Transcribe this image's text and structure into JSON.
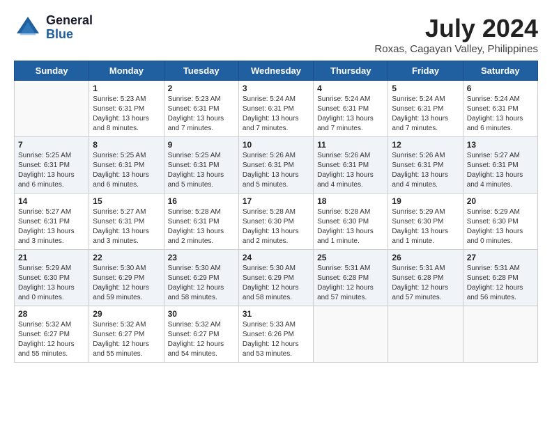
{
  "header": {
    "logo_general": "General",
    "logo_blue": "Blue",
    "month_year": "July 2024",
    "location": "Roxas, Cagayan Valley, Philippines"
  },
  "weekdays": [
    "Sunday",
    "Monday",
    "Tuesday",
    "Wednesday",
    "Thursday",
    "Friday",
    "Saturday"
  ],
  "weeks": [
    [
      {
        "day": "",
        "empty": true
      },
      {
        "day": "1",
        "sunrise": "Sunrise: 5:23 AM",
        "sunset": "Sunset: 6:31 PM",
        "daylight": "Daylight: 13 hours and 8 minutes."
      },
      {
        "day": "2",
        "sunrise": "Sunrise: 5:23 AM",
        "sunset": "Sunset: 6:31 PM",
        "daylight": "Daylight: 13 hours and 7 minutes."
      },
      {
        "day": "3",
        "sunrise": "Sunrise: 5:24 AM",
        "sunset": "Sunset: 6:31 PM",
        "daylight": "Daylight: 13 hours and 7 minutes."
      },
      {
        "day": "4",
        "sunrise": "Sunrise: 5:24 AM",
        "sunset": "Sunset: 6:31 PM",
        "daylight": "Daylight: 13 hours and 7 minutes."
      },
      {
        "day": "5",
        "sunrise": "Sunrise: 5:24 AM",
        "sunset": "Sunset: 6:31 PM",
        "daylight": "Daylight: 13 hours and 7 minutes."
      },
      {
        "day": "6",
        "sunrise": "Sunrise: 5:24 AM",
        "sunset": "Sunset: 6:31 PM",
        "daylight": "Daylight: 13 hours and 6 minutes."
      }
    ],
    [
      {
        "day": "7",
        "sunrise": "Sunrise: 5:25 AM",
        "sunset": "Sunset: 6:31 PM",
        "daylight": "Daylight: 13 hours and 6 minutes."
      },
      {
        "day": "8",
        "sunrise": "Sunrise: 5:25 AM",
        "sunset": "Sunset: 6:31 PM",
        "daylight": "Daylight: 13 hours and 6 minutes."
      },
      {
        "day": "9",
        "sunrise": "Sunrise: 5:25 AM",
        "sunset": "Sunset: 6:31 PM",
        "daylight": "Daylight: 13 hours and 5 minutes."
      },
      {
        "day": "10",
        "sunrise": "Sunrise: 5:26 AM",
        "sunset": "Sunset: 6:31 PM",
        "daylight": "Daylight: 13 hours and 5 minutes."
      },
      {
        "day": "11",
        "sunrise": "Sunrise: 5:26 AM",
        "sunset": "Sunset: 6:31 PM",
        "daylight": "Daylight: 13 hours and 4 minutes."
      },
      {
        "day": "12",
        "sunrise": "Sunrise: 5:26 AM",
        "sunset": "Sunset: 6:31 PM",
        "daylight": "Daylight: 13 hours and 4 minutes."
      },
      {
        "day": "13",
        "sunrise": "Sunrise: 5:27 AM",
        "sunset": "Sunset: 6:31 PM",
        "daylight": "Daylight: 13 hours and 4 minutes."
      }
    ],
    [
      {
        "day": "14",
        "sunrise": "Sunrise: 5:27 AM",
        "sunset": "Sunset: 6:31 PM",
        "daylight": "Daylight: 13 hours and 3 minutes."
      },
      {
        "day": "15",
        "sunrise": "Sunrise: 5:27 AM",
        "sunset": "Sunset: 6:31 PM",
        "daylight": "Daylight: 13 hours and 3 minutes."
      },
      {
        "day": "16",
        "sunrise": "Sunrise: 5:28 AM",
        "sunset": "Sunset: 6:31 PM",
        "daylight": "Daylight: 13 hours and 2 minutes."
      },
      {
        "day": "17",
        "sunrise": "Sunrise: 5:28 AM",
        "sunset": "Sunset: 6:30 PM",
        "daylight": "Daylight: 13 hours and 2 minutes."
      },
      {
        "day": "18",
        "sunrise": "Sunrise: 5:28 AM",
        "sunset": "Sunset: 6:30 PM",
        "daylight": "Daylight: 13 hours and 1 minute."
      },
      {
        "day": "19",
        "sunrise": "Sunrise: 5:29 AM",
        "sunset": "Sunset: 6:30 PM",
        "daylight": "Daylight: 13 hours and 1 minute."
      },
      {
        "day": "20",
        "sunrise": "Sunrise: 5:29 AM",
        "sunset": "Sunset: 6:30 PM",
        "daylight": "Daylight: 13 hours and 0 minutes."
      }
    ],
    [
      {
        "day": "21",
        "sunrise": "Sunrise: 5:29 AM",
        "sunset": "Sunset: 6:30 PM",
        "daylight": "Daylight: 13 hours and 0 minutes."
      },
      {
        "day": "22",
        "sunrise": "Sunrise: 5:30 AM",
        "sunset": "Sunset: 6:29 PM",
        "daylight": "Daylight: 12 hours and 59 minutes."
      },
      {
        "day": "23",
        "sunrise": "Sunrise: 5:30 AM",
        "sunset": "Sunset: 6:29 PM",
        "daylight": "Daylight: 12 hours and 58 minutes."
      },
      {
        "day": "24",
        "sunrise": "Sunrise: 5:30 AM",
        "sunset": "Sunset: 6:29 PM",
        "daylight": "Daylight: 12 hours and 58 minutes."
      },
      {
        "day": "25",
        "sunrise": "Sunrise: 5:31 AM",
        "sunset": "Sunset: 6:28 PM",
        "daylight": "Daylight: 12 hours and 57 minutes."
      },
      {
        "day": "26",
        "sunrise": "Sunrise: 5:31 AM",
        "sunset": "Sunset: 6:28 PM",
        "daylight": "Daylight: 12 hours and 57 minutes."
      },
      {
        "day": "27",
        "sunrise": "Sunrise: 5:31 AM",
        "sunset": "Sunset: 6:28 PM",
        "daylight": "Daylight: 12 hours and 56 minutes."
      }
    ],
    [
      {
        "day": "28",
        "sunrise": "Sunrise: 5:32 AM",
        "sunset": "Sunset: 6:27 PM",
        "daylight": "Daylight: 12 hours and 55 minutes."
      },
      {
        "day": "29",
        "sunrise": "Sunrise: 5:32 AM",
        "sunset": "Sunset: 6:27 PM",
        "daylight": "Daylight: 12 hours and 55 minutes."
      },
      {
        "day": "30",
        "sunrise": "Sunrise: 5:32 AM",
        "sunset": "Sunset: 6:27 PM",
        "daylight": "Daylight: 12 hours and 54 minutes."
      },
      {
        "day": "31",
        "sunrise": "Sunrise: 5:33 AM",
        "sunset": "Sunset: 6:26 PM",
        "daylight": "Daylight: 12 hours and 53 minutes."
      },
      {
        "day": "",
        "empty": true
      },
      {
        "day": "",
        "empty": true
      },
      {
        "day": "",
        "empty": true
      }
    ]
  ]
}
